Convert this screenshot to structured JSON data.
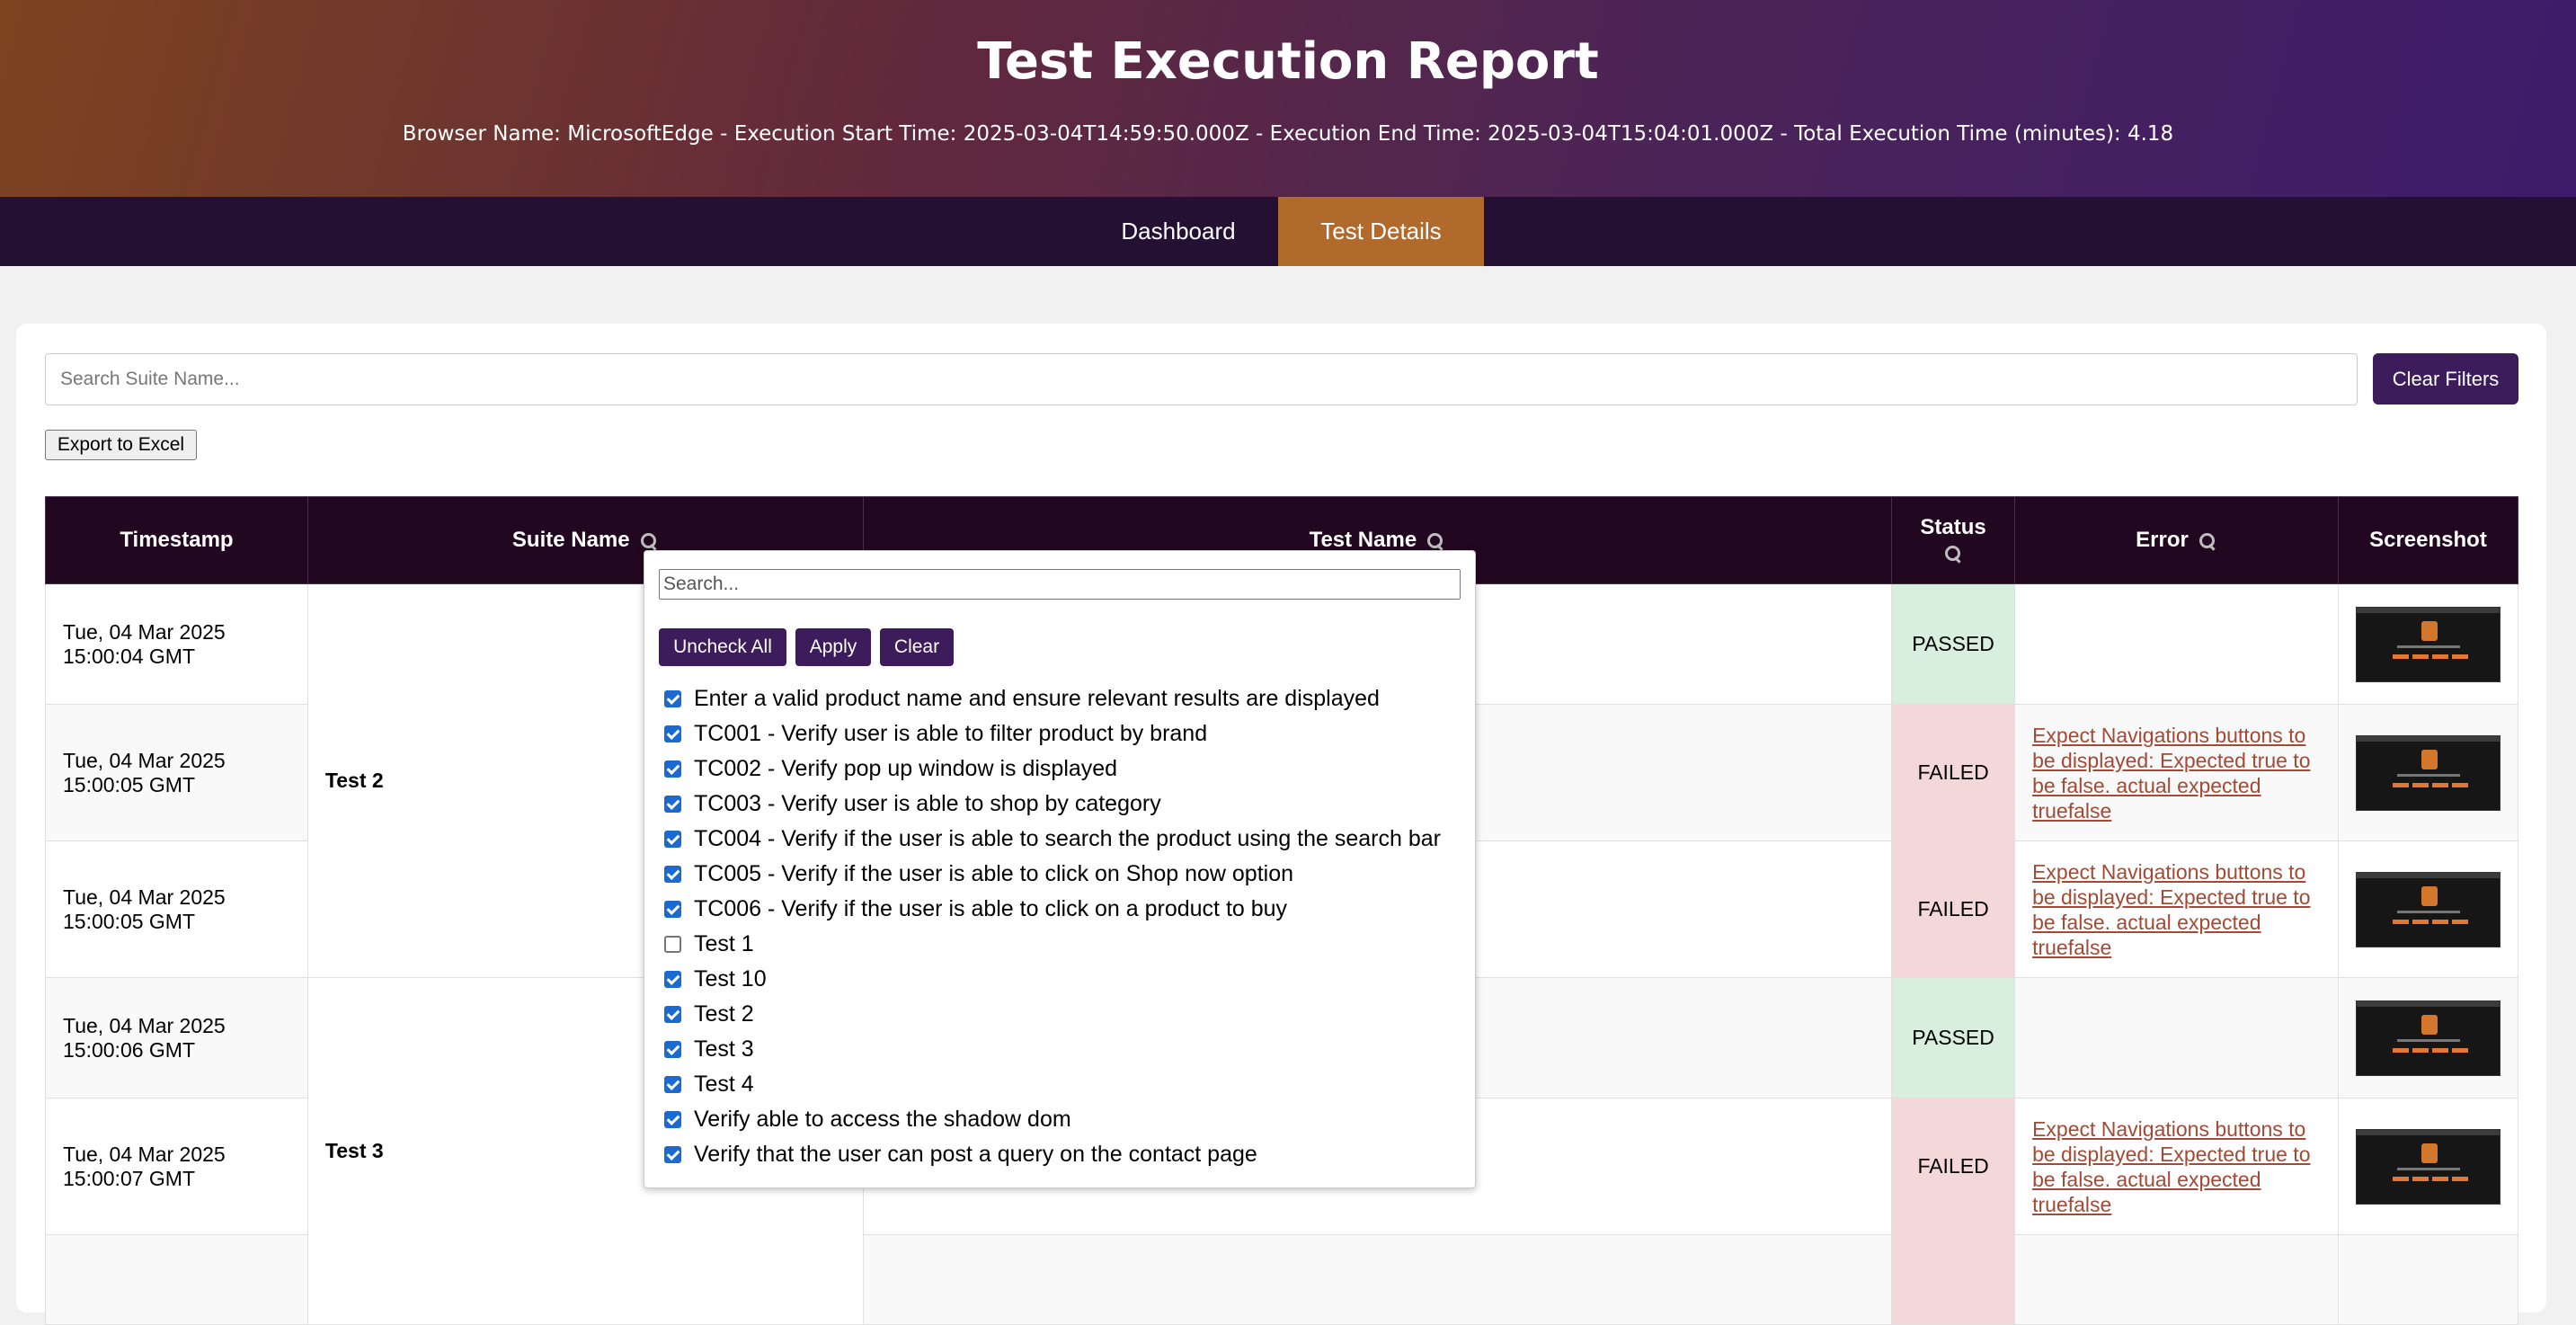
{
  "header": {
    "title": "Test Execution Report",
    "subtitle": "Browser Name: MicrosoftEdge - Execution Start Time: 2025-03-04T14:59:50.000Z - Execution End Time: 2025-03-04T15:04:01.000Z - Total Execution Time (minutes): 4.18"
  },
  "nav": {
    "dashboard": "Dashboard",
    "details": "Test Details",
    "active": "Test Details"
  },
  "toolbar": {
    "search_placeholder": "Search Suite Name...",
    "clear_filters": "Clear Filters",
    "export": "Export to Excel"
  },
  "table": {
    "headers": {
      "timestamp": "Timestamp",
      "suite": "Suite Name",
      "test": "Test Name",
      "status": "Status",
      "error": "Error",
      "screenshot": "Screenshot"
    },
    "rows": [
      {
        "ts1": "Tue, 04 Mar 2025",
        "ts2": "15:00:04 GMT",
        "status": "PASSED",
        "error": [
          "",
          "",
          "",
          ""
        ]
      },
      {
        "ts1": "Tue, 04 Mar 2025",
        "ts2": "15:00:05 GMT",
        "status": "FAILED",
        "error": [
          "Expect Navigations buttons to",
          "be displayed: Expected true to",
          "be false. actual expected",
          "truefalse"
        ]
      },
      {
        "ts1": "Tue, 04 Mar 2025",
        "ts2": "15:00:05 GMT",
        "status": "FAILED",
        "error": [
          "Expect Navigations buttons to",
          "be displayed: Expected true to",
          "be false. actual expected",
          "truefalse"
        ]
      },
      {
        "ts1": "Tue, 04 Mar 2025",
        "ts2": "15:00:06 GMT",
        "status": "PASSED",
        "error": [
          "",
          "",
          "",
          ""
        ]
      },
      {
        "ts1": "Tue, 04 Mar 2025",
        "ts2": "15:00:07 GMT",
        "status": "FAILED",
        "error": [
          "Expect Navigations buttons to",
          "be displayed: Expected true to",
          "be false. actual expected",
          "truefalse"
        ]
      }
    ],
    "suites": [
      "Test 2",
      "Test 3"
    ]
  },
  "filter_popup": {
    "search_placeholder": "Search...",
    "uncheck_all": "Uncheck All",
    "apply": "Apply",
    "clear": "Clear",
    "items": [
      {
        "label": "Enter a valid product name and ensure relevant results are displayed",
        "checked": true
      },
      {
        "label": "TC001 - Verify user is able to filter product by brand",
        "checked": true
      },
      {
        "label": "TC002 - Verify pop up window is displayed",
        "checked": true
      },
      {
        "label": "TC003 - Verify user is able to shop by category",
        "checked": true
      },
      {
        "label": "TC004 - Verify if the user is able to search the product using the search bar",
        "checked": true
      },
      {
        "label": "TC005 - Verify if the user is able to click on Shop now option",
        "checked": true
      },
      {
        "label": "TC006 - Verify if the user is able to click on a product to buy",
        "checked": true
      },
      {
        "label": "Test 1",
        "checked": false
      },
      {
        "label": "Test 10",
        "checked": true
      },
      {
        "label": "Test 2",
        "checked": true
      },
      {
        "label": "Test 3",
        "checked": true
      },
      {
        "label": "Test 4",
        "checked": true
      },
      {
        "label": "Verify able to access the shadow dom",
        "checked": true
      },
      {
        "label": "Verify that the user can post a query on the contact page",
        "checked": true
      }
    ]
  },
  "colors": {
    "passed_bg": "#d8efdd",
    "failed_bg": "#f4d7d8",
    "accent": "#3c1c5a",
    "tab_active": "#b06a2c"
  }
}
